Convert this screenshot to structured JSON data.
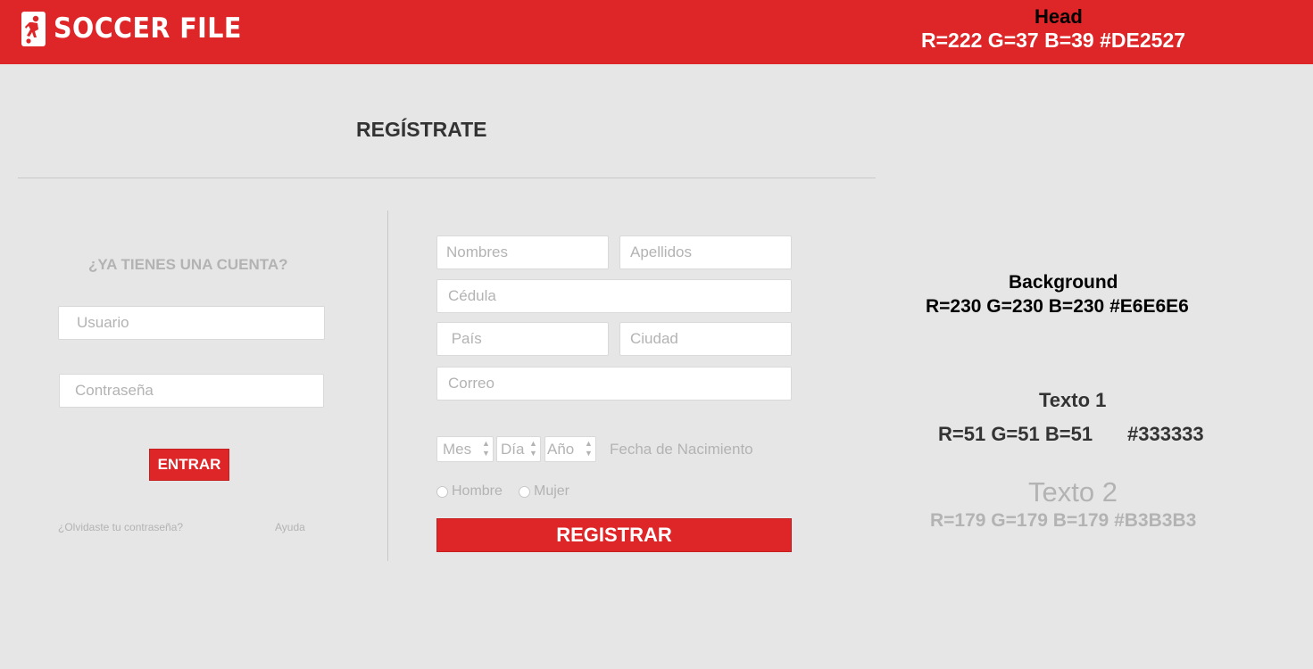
{
  "header": {
    "logo_text": "SOCCER FILE",
    "logo_icon": "soccer-player-icon",
    "color": "#DE2527"
  },
  "specs": {
    "head_title": "Head",
    "head_values": "R=222 G=37 B=39   #DE2527",
    "bg_title": "Background",
    "bg_values": "R=230 G=230 B=230  #E6E6E6",
    "t1_title": "Texto 1",
    "t1_rgb": "R=51 G=51 B=51",
    "t1_hex": "#333333",
    "t2_title": "Texto 2",
    "t2_values": "R=179 G=179 B=179 #B3B3B3"
  },
  "page_title": "REGÍSTRATE",
  "login": {
    "title": "¿YA TIENES UNA CUENTA?",
    "user_placeholder": "Usuario",
    "password_placeholder": "Contraseña",
    "enter_label": "ENTRAR",
    "forgot_label": "¿Olvidaste tu contraseña?",
    "help_label": "Ayuda"
  },
  "register": {
    "first_name_placeholder": "Nombres",
    "last_name_placeholder": "Apellidos",
    "id_placeholder": "Cédula",
    "country_placeholder": " País",
    "city_placeholder": "Ciudad",
    "email_placeholder": "Correo",
    "month": "Mes",
    "day": "Día",
    "year": "Año",
    "birth_label": "Fecha de Nacimiento",
    "male_label": "Hombre",
    "female_label": "Mujer",
    "submit_label": "REGISTRAR"
  },
  "colors": {
    "head": "#DE2527",
    "background": "#E6E6E6",
    "text1": "#333333",
    "text2": "#B3B3B3"
  }
}
